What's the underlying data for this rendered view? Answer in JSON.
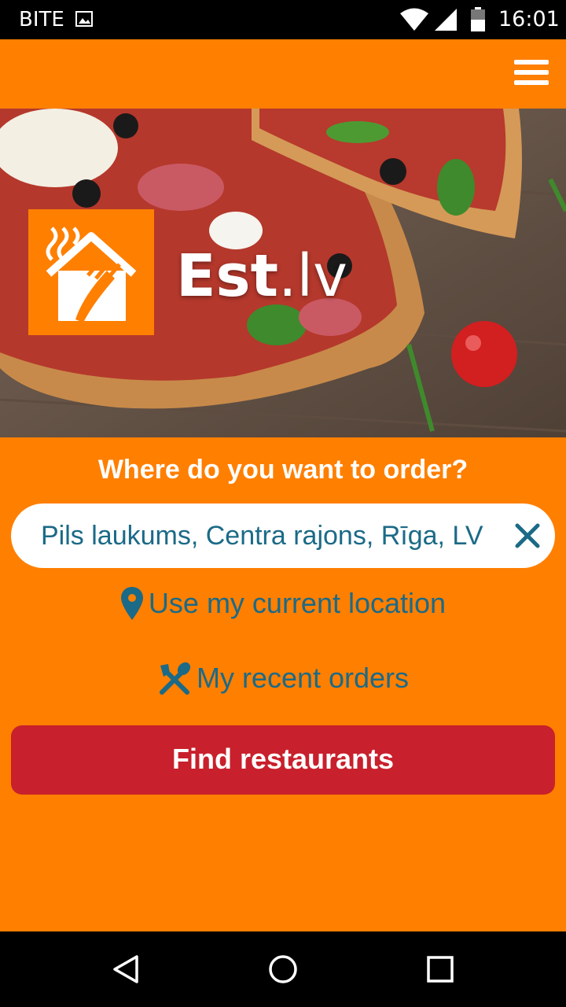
{
  "status_bar": {
    "carrier": "BITE",
    "time": "16:01"
  },
  "hero": {
    "brand_main": "Est",
    "brand_dot": ".",
    "brand_tld": "lv"
  },
  "question": "Where do you want to order?",
  "search": {
    "value": "Pils laukums, Centra rajons, Rīga, LV",
    "placeholder": ""
  },
  "links": {
    "current_location": "Use my current location",
    "recent_orders": "My recent orders"
  },
  "find_button": "Find restaurants",
  "colors": {
    "accent": "#ff7f00",
    "button": "#c8202c",
    "link": "#1b6a87"
  },
  "icons": [
    "image-icon",
    "wifi-icon",
    "signal-icon",
    "battery-icon",
    "menu-icon",
    "logo-house-icon",
    "close-icon",
    "location-pin-icon",
    "cutlery-icon",
    "back-icon",
    "home-icon",
    "recents-icon"
  ]
}
